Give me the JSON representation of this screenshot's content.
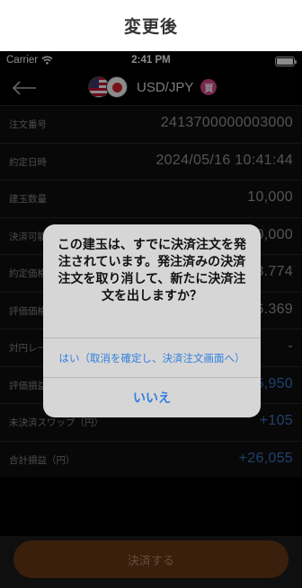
{
  "caption": "変更後",
  "status_bar": {
    "carrier": "Carrier",
    "time": "2:41 PM"
  },
  "header": {
    "pair": "USD/JPY",
    "side": "買"
  },
  "rows": [
    {
      "label": "注文番号",
      "value": "2413700000003000"
    },
    {
      "label": "約定日時",
      "value": "2024/05/16 10:41:44"
    },
    {
      "label": "建玉数量",
      "value": "10,000"
    },
    {
      "label": "決済可能数量",
      "value": "10,000"
    },
    {
      "label": "約定価格",
      "value": "153.774"
    },
    {
      "label": "評価価格",
      "value": "156.369"
    },
    {
      "label": "対円レート",
      "value": "-"
    },
    {
      "label": "評価損益（円）",
      "value": "+25,950"
    },
    {
      "label": "未決済スワップ（円）",
      "value": "+105"
    },
    {
      "label": "合計損益（円）",
      "value": "+26,055"
    }
  ],
  "footer": {
    "button": "決済する"
  },
  "dialog": {
    "message": "この建玉は、すでに決済注文を発注されています。発注済みの決済注文を取り消して、新たに決済注文を出しますか？",
    "yes": "はい（取消を確定し、決済注文画面へ）",
    "no": "いいえ"
  },
  "colors": {
    "accent": "#2f7fe0",
    "positive": "#3a78c8",
    "button": "#6b3a18",
    "badge": "#e0478c"
  }
}
